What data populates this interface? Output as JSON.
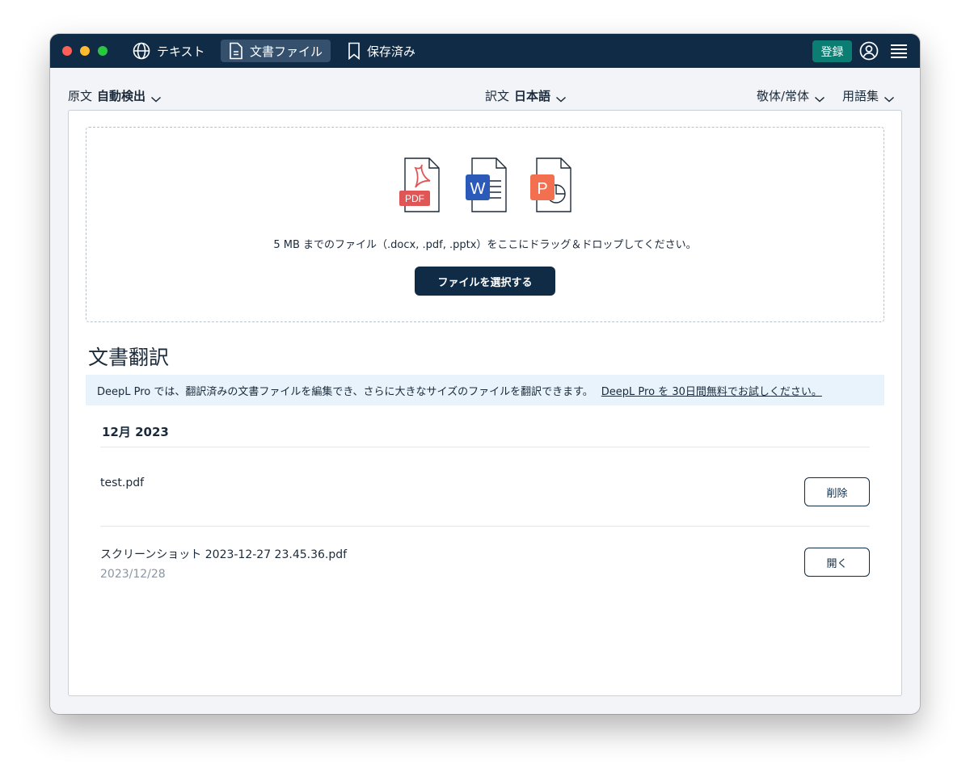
{
  "nav": {
    "tabs": [
      {
        "label": "テキスト",
        "icon": "globe-icon"
      },
      {
        "label": "文書ファイル",
        "icon": "document-icon"
      },
      {
        "label": "保存済み",
        "icon": "bookmark-icon"
      }
    ],
    "active_tab": "文書ファイル",
    "signup_label": "登録"
  },
  "toolbar": {
    "source_label": "原文",
    "source_value": "自動検出",
    "target_label": "訳文",
    "target_value": "日本語",
    "formality": "敬体/常体",
    "glossary": "用語集"
  },
  "dropzone": {
    "file_types": [
      "PDF",
      "W",
      "P"
    ],
    "hint": "5 MB までのファイル（.docx, .pdf, .pptx）をここにドラッグ＆ドロップしてください。",
    "button_label": "ファイルを選択する"
  },
  "section_title": "文書翻訳",
  "promo": {
    "text": "DeepL Pro では、翻訳済みの文書ファイルを編集でき、さらに大きなサイズのファイルを翻訳できます。",
    "link": "DeepL Pro を 30日間無料でお試しください。"
  },
  "history": {
    "month": "12月 2023",
    "files": [
      {
        "name": "test.pdf",
        "date": "",
        "action": "削除"
      },
      {
        "name": "スクリーンショット 2023-12-27 23.45.36.pdf",
        "date": "2023/12/28",
        "action": "開く"
      }
    ]
  },
  "colors": {
    "titlebar": "#0f2b46",
    "signup": "#0b7d72",
    "pdf": "#e05656",
    "word": "#2b5ab8",
    "ppt": "#f2704f"
  }
}
